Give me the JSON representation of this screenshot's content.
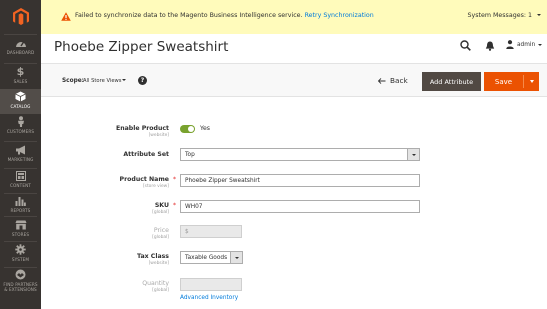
{
  "sidebar": {
    "logo": "magento-logo",
    "items": [
      {
        "label": "DASHBOARD",
        "icon": "dashboard-icon"
      },
      {
        "label": "SALES",
        "icon": "dollar-icon"
      },
      {
        "label": "CATALOG",
        "icon": "cube-icon",
        "active": true
      },
      {
        "label": "CUSTOMERS",
        "icon": "person-icon"
      },
      {
        "label": "MARKETING",
        "icon": "megaphone-icon"
      },
      {
        "label": "CONTENT",
        "icon": "layout-icon"
      },
      {
        "label": "REPORTS",
        "icon": "bar-chart-icon"
      },
      {
        "label": "STORES",
        "icon": "store-icon"
      },
      {
        "label": "SYSTEM",
        "icon": "gear-icon"
      },
      {
        "label": "FIND PARTNERS & EXTENSIONS",
        "icon": "partners-icon"
      }
    ]
  },
  "system_message": {
    "text": "Failed to synchronize data to the Magento Business Intelligence service.",
    "link": "Retry Synchronization",
    "counter": "System Messages: 1"
  },
  "header": {
    "title": "Phoebe Zipper Sweatshirt",
    "user": "admin"
  },
  "actions": {
    "scope_label": "Scope:",
    "scope_value": "All Store Views",
    "help": "?",
    "back": "Back",
    "add_attribute": "Add Attribute",
    "save": "Save"
  },
  "form": {
    "enable_label": "Enable Product",
    "enable_scope": "[website]",
    "enable_value": "Yes",
    "attrset_label": "Attribute Set",
    "attrset_value": "Top",
    "name_label": "Product Name",
    "name_scope": "[store view]",
    "name_value": "Phoebe Zipper Sweatshirt",
    "sku_label": "SKU",
    "sku_scope": "[global]",
    "sku_value": "WH07",
    "price_label": "Price",
    "price_scope": "[global]",
    "price_symbol": "$",
    "tax_label": "Tax Class",
    "tax_scope": "[website]",
    "tax_value": "Taxable Goods",
    "qty_label": "Quantity",
    "qty_scope": "[global]",
    "advanced_inventory": "Advanced Inventory",
    "required_mark": "*"
  },
  "colors": {
    "sidebar_bg": "#373330",
    "accent_orange": "#eb5202",
    "toggle_on": "#79a22e",
    "link_blue": "#007bdb",
    "notice_bg": "#fffbbb"
  }
}
